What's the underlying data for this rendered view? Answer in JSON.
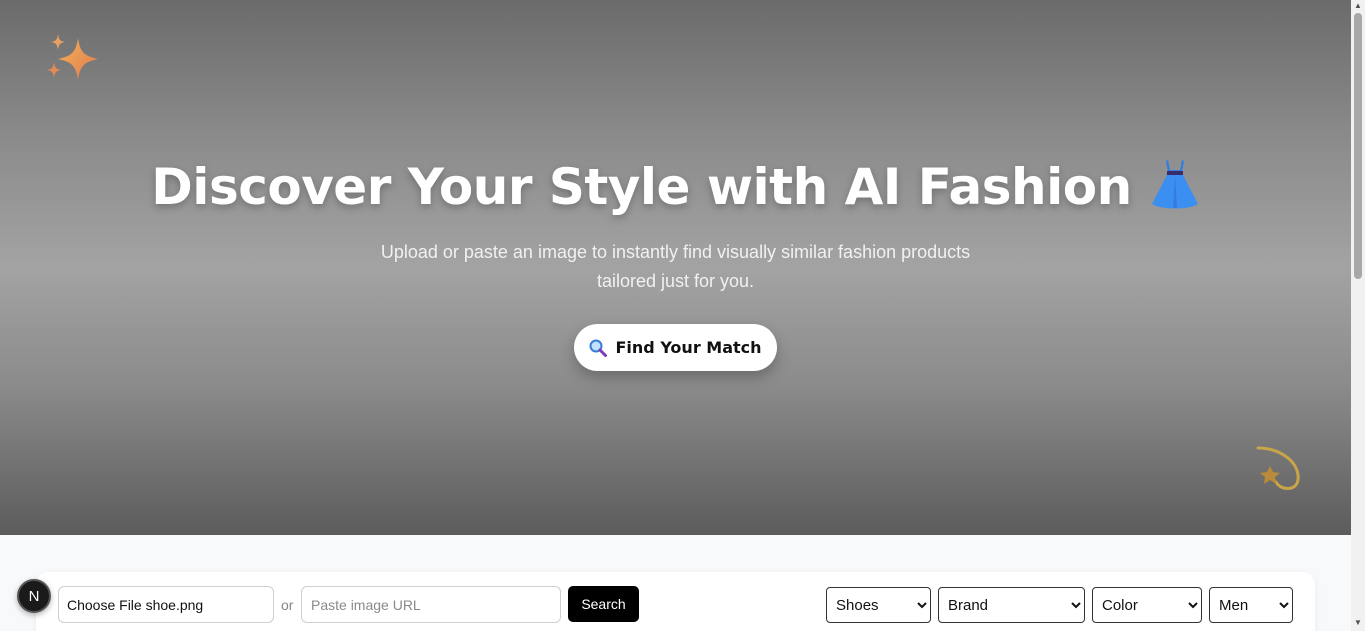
{
  "hero": {
    "title": "Discover Your Style with AI Fashion",
    "subtitle_line1": "Upload or paste an image to instantly find visually similar fashion products",
    "subtitle_line2": "tailored just for you.",
    "cta_label": "Find Your Match",
    "cta_icon": "magnifier-icon",
    "title_icon": "dress-icon"
  },
  "decor": {
    "top_left_icon": "sparkles-icon",
    "bottom_right_icon": "shooting-star-icon"
  },
  "search_bar": {
    "badge_letter": "N",
    "file_label": "Choose File shoe.png",
    "or_text": "or",
    "url_placeholder": "Paste image URL",
    "url_value": "",
    "search_label": "Search",
    "category": {
      "selected": "Shoes"
    },
    "brand": {
      "selected": "Brand"
    },
    "color": {
      "selected": "Color"
    },
    "gender": {
      "selected": "Men"
    }
  },
  "colors": {
    "cta_background": "#ffffff",
    "search_button": "#000000"
  }
}
